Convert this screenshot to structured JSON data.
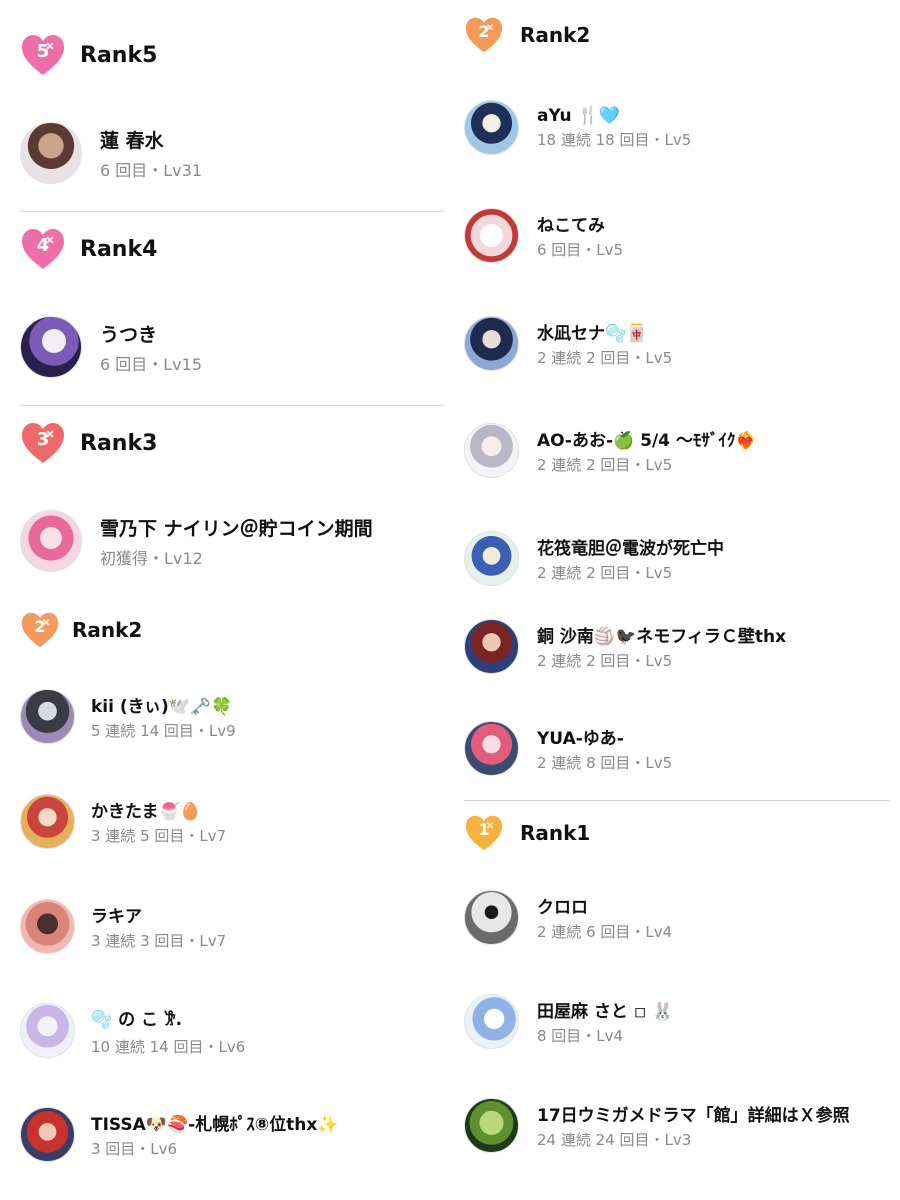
{
  "colors": {
    "rank5_heart": "#ee6fa8",
    "rank4_heart": "#ee6fa8",
    "rank3_heart": "#ee6a6a",
    "rank2_heart": "#f59a5a",
    "rank1_heart": "#f6b23e",
    "divider": "#d6d6d6",
    "meta_text": "#8a8a8a"
  },
  "left": {
    "rank5": {
      "title": "Rank5",
      "number": "5",
      "entries": [
        {
          "name": "蓮 春水",
          "meta": "6 回目・Lv31"
        }
      ]
    },
    "rank4": {
      "title": "Rank4",
      "number": "4",
      "entries": [
        {
          "name": "うつき",
          "meta": "6 回目・Lv15"
        }
      ]
    },
    "rank3": {
      "title": "Rank3",
      "number": "3",
      "entries": [
        {
          "name": "雪乃下 ナイリン＠貯コイン期間",
          "meta": "初獲得・Lv12"
        }
      ]
    },
    "rank2": {
      "title": "Rank2",
      "number": "2",
      "entries": [
        {
          "name": "kii (きぃ)🕊️🗝️🍀",
          "meta": "5 連続 14 回目・Lv9"
        },
        {
          "name": "かきたま🍧🥚",
          "meta": "3 連続 5 回目・Lv7"
        },
        {
          "name": "ラキア",
          "meta": "3 連続 3 回目・Lv7"
        },
        {
          "name": "🫧 の こ 𐦂.",
          "meta": "10 連続 14 回目・Lv6"
        },
        {
          "name": "TISSA🐶🍣-札幌ﾎﾟｽ⑧位thx✨",
          "meta": "3 回目・Lv6"
        }
      ]
    }
  },
  "right": {
    "rank2": {
      "title": "Rank2",
      "number": "2",
      "entries": [
        {
          "name": "aYu 🍴🩵",
          "meta": "18 連続 18 回目・Lv5"
        },
        {
          "name": "ねこてみ",
          "meta": "6 回目・Lv5"
        },
        {
          "name": "水凪セナ🫧🀄",
          "meta": "2 連続 2 回目・Lv5"
        },
        {
          "name": "AO-あお-🍏 5/4 〜ﾓｻﾞｲｸ❤️‍🔥",
          "meta": "2 連続 2 回目・Lv5"
        },
        {
          "name": "花筏竜胆＠電波が死亡中",
          "meta": "2 連続 2 回目・Lv5"
        },
        {
          "name": "銅 沙南🏐🐦‍⬛ネモフィラＣ壁thx",
          "meta": "2 連続 2 回目・Lv5"
        },
        {
          "name": "YUA-ゆあ-",
          "meta": "2 連続 8 回目・Lv5"
        }
      ]
    },
    "rank1": {
      "title": "Rank1",
      "number": "1",
      "entries": [
        {
          "name": "クロロ",
          "meta": "2 連続 6 回目・Lv4"
        },
        {
          "name": "田屋麻 さと ◽ 🐰",
          "meta": "8 回目・Lv4"
        },
        {
          "name": "17日ウミガメドラマ「館」詳細はＸ参照",
          "meta": "24 連続 24 回目・Lv3"
        }
      ]
    }
  }
}
